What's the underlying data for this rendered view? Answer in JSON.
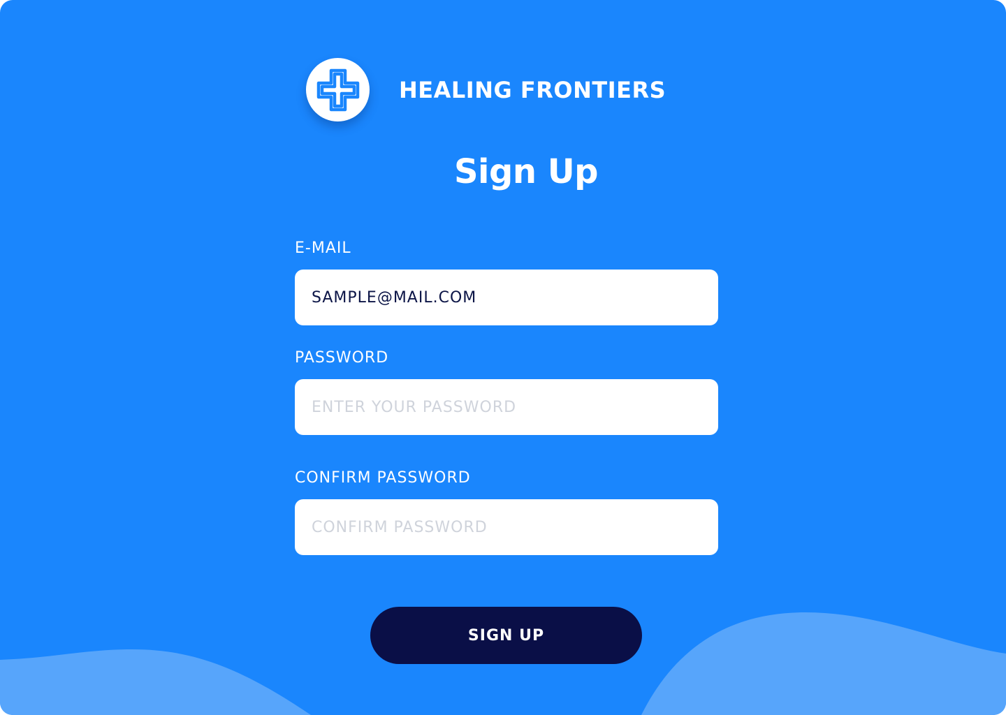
{
  "brand": {
    "name": "HEALING FRONTIERS",
    "logo_icon": "medical-cross-icon"
  },
  "page": {
    "title": "Sign Up"
  },
  "form": {
    "email": {
      "label": "E-MAIL",
      "value": "SAMPLE@MAIL.COM",
      "placeholder": ""
    },
    "password": {
      "label": "PASSWORD",
      "value": "",
      "placeholder": "ENTER YOUR PASSWORD"
    },
    "confirm_password": {
      "label": "CONFIRM PASSWORD",
      "value": "",
      "placeholder": "CONFIRM PASSWORD"
    },
    "submit_label": "SIGN UP"
  },
  "colors": {
    "background": "#1a86fd",
    "wave": "#57a5fb",
    "button": "#0a0f47",
    "input_text": "#0b1446",
    "placeholder": "#cfd3db"
  }
}
